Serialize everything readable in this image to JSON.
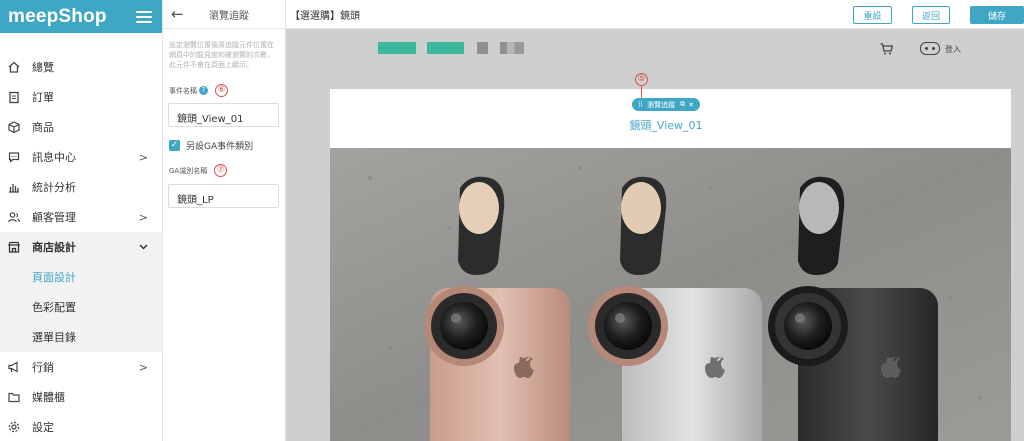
{
  "sidebar": {
    "logo": "meepShop",
    "items": [
      {
        "label": "總覽",
        "icon": "home-icon",
        "chevron": ""
      },
      {
        "label": "訂單",
        "icon": "clipboard-icon",
        "chevron": ""
      },
      {
        "label": "商品",
        "icon": "box-icon",
        "chevron": ""
      },
      {
        "label": "訊息中心",
        "icon": "chat-icon",
        "chevron": ">"
      },
      {
        "label": "統計分析",
        "icon": "bar-chart-icon",
        "chevron": ""
      },
      {
        "label": "顧客管理",
        "icon": "users-icon",
        "chevron": ">"
      },
      {
        "label": "商店設計",
        "icon": "store-icon",
        "chevron": "⌄"
      },
      {
        "label": "行銷",
        "icon": "megaphone-icon",
        "chevron": ">"
      },
      {
        "label": "媒體櫃",
        "icon": "folder-icon",
        "chevron": ""
      },
      {
        "label": "設定",
        "icon": "gear-icon",
        "chevron": ""
      }
    ],
    "subitems": [
      {
        "label": "頁面設計"
      },
      {
        "label": "色彩配置"
      },
      {
        "label": "選單目錄"
      }
    ]
  },
  "panel": {
    "title": "瀏覽追蹤",
    "description": "設定瀏覽位置後將追蹤元件位置在網頁中的能見度和被瀏覽的次數，此元件不會在頁面上顯示。",
    "event_label": "事件名稱",
    "event_help": "?",
    "event_mark": "⑥",
    "event_value": "鏡頭_View_01",
    "checkbox_label": "另設GA事件類別",
    "checkbox_mark": "✓",
    "ga_label": "GA識別名稱",
    "ga_mark": "⑦",
    "ga_value": "鏡頭_LP"
  },
  "topbar": {
    "page_title": "【選選購】鏡頭",
    "reset": "重設",
    "back": "返回",
    "save": "儲存"
  },
  "canvas": {
    "login": "登入",
    "mark": "⑤",
    "pill_label": "瀏覽追蹤",
    "tracking_title": "鏡頭_View_01"
  },
  "colors": {
    "accent": "#3fa6c4",
    "annotation": "#d9534f",
    "pixel_green": "#3cb89a"
  }
}
